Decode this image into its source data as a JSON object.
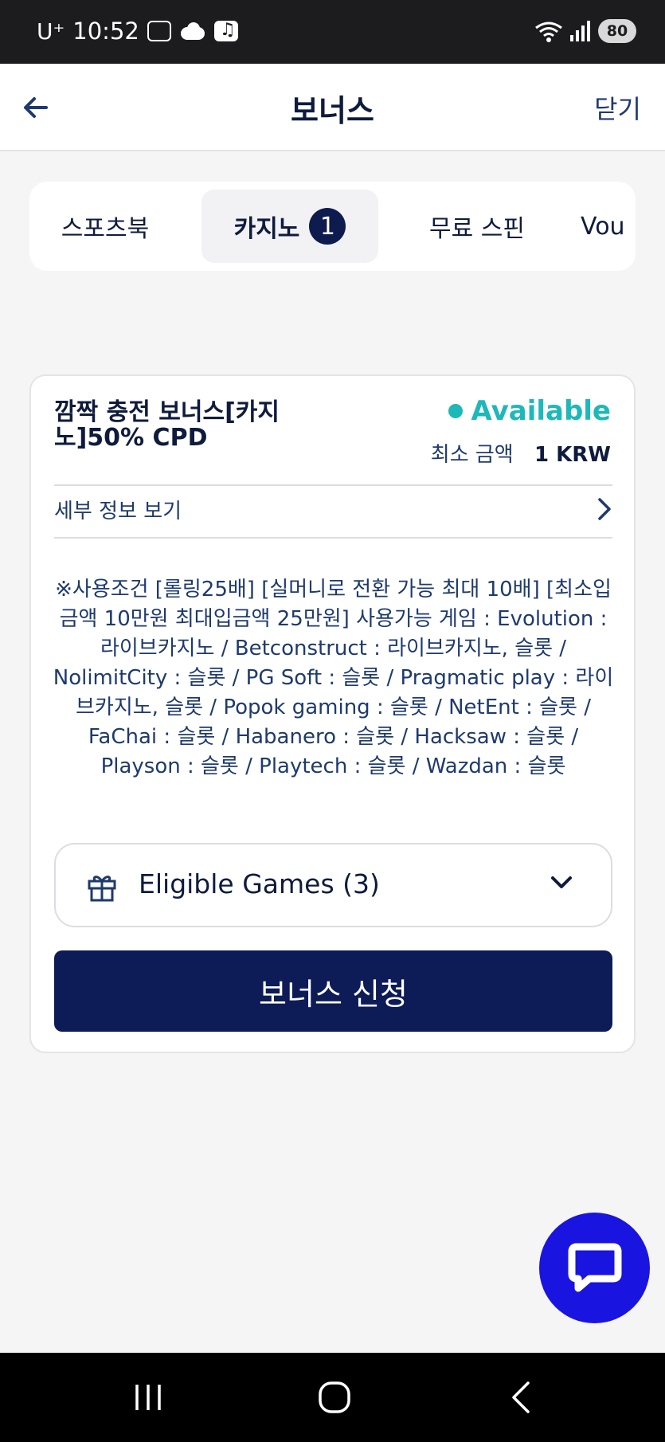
{
  "status_bar": {
    "carrier": "U⁺",
    "time": "10:52",
    "battery": "80"
  },
  "header": {
    "title": "보너스",
    "close_label": "닫기",
    "back_icon": "arrow-left-icon"
  },
  "tabs": [
    {
      "label": "스포츠북"
    },
    {
      "label": "카지노",
      "badge": "1",
      "active": true
    },
    {
      "label": "무료 스핀"
    },
    {
      "label": "Vou"
    }
  ],
  "bonus_card": {
    "title": "깜짝 충전 보너스[카지노]50% CPD",
    "status": "Available",
    "min_amount_label": "최소 금액",
    "min_amount_value": "1 KRW",
    "details_label": "세부 정보 보기",
    "conditions": "※사용조건 [롤링25배] [실머니로 전환 가능 최대 10배] [최소입금액 10만원 최대입금액 25만원] 사용가능 게임 : Evolution : 라이브카지노 / Betconstruct : 라이브카지노, 슬롯 / NolimitCity : 슬롯 / PG Soft : 슬롯 / Pragmatic play : 라이브카지노, 슬롯 / Popok gaming : 슬롯 / NetEnt : 슬롯 / FaChai : 슬롯 / Habanero : 슬롯 / Hacksaw : 슬롯 / Playson : 슬롯 / Playtech : 슬롯 / Wazdan : 슬롯",
    "eligible_games_label": "Eligible Games (3)",
    "apply_label": "보너스 신청"
  },
  "colors": {
    "accent_navy": "#0d1b57",
    "available_teal": "#1eb8b8",
    "chat_blue": "#1a14e0"
  },
  "icons": {
    "gift": "gift-icon",
    "chevron": "chevron-down-icon",
    "details": "chevron-right-icon",
    "chat": "chat-bubble-icon"
  }
}
